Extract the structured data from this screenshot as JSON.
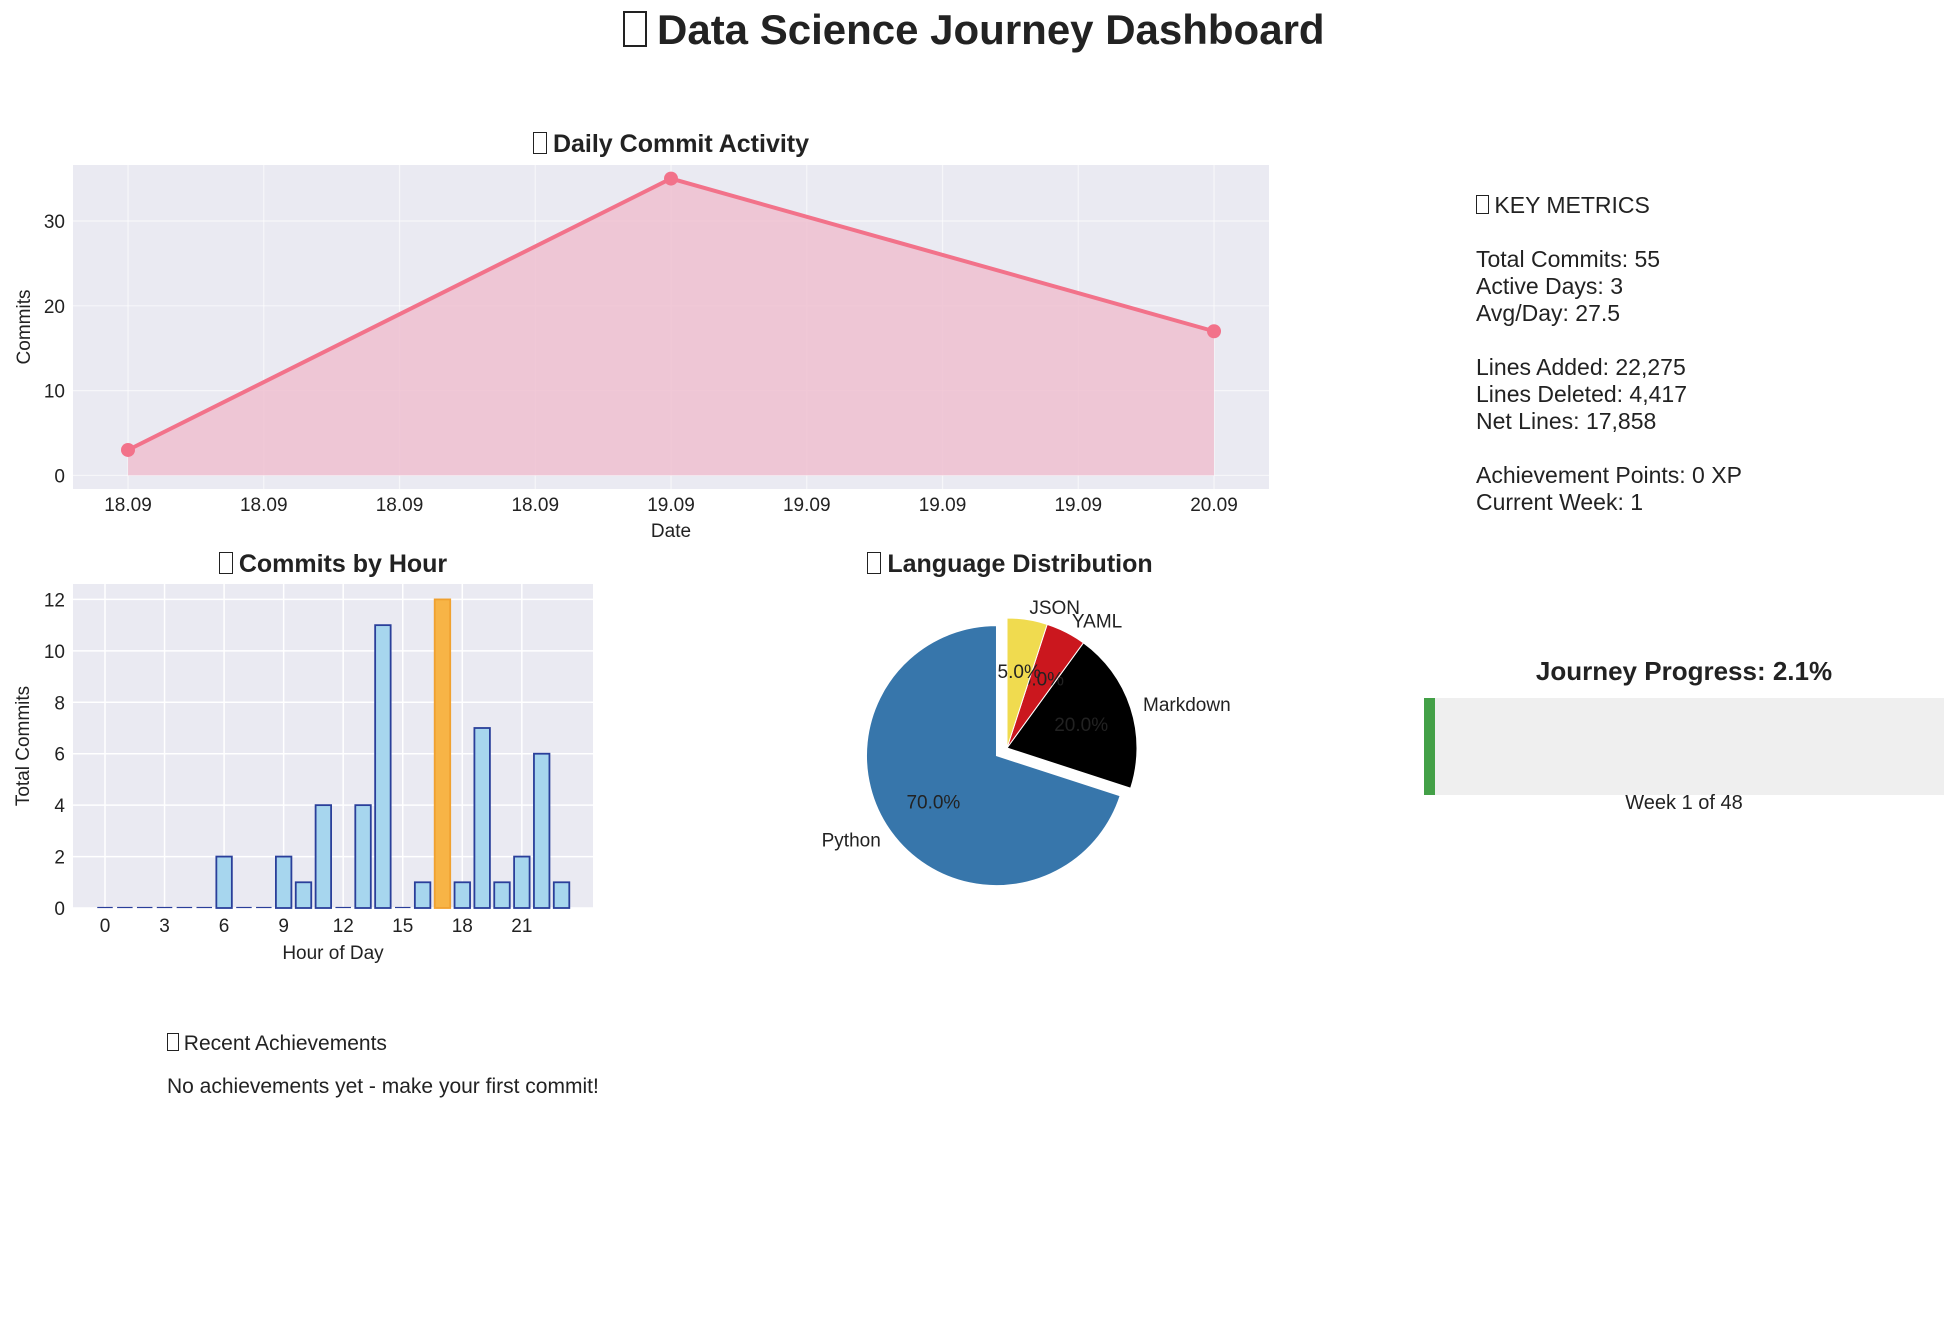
{
  "dashboard": {
    "title": "Data Science Journey Dashboard",
    "title_icon": "chart-emoji-icon"
  },
  "chart_data": [
    {
      "id": "daily",
      "type": "area",
      "title": "Daily Commit Activity",
      "title_icon": "emoji-icon",
      "xlabel": "Date",
      "ylabel": "Commits",
      "x_ticks": [
        "18.09",
        "18.09",
        "18.09",
        "18.09",
        "19.09",
        "19.09",
        "19.09",
        "19.09",
        "20.09"
      ],
      "x": [
        "18.09",
        "19.09",
        "20.09"
      ],
      "values": [
        3,
        35,
        17
      ],
      "y_ticks": [
        0,
        10,
        20,
        30
      ],
      "ylim": [
        -1.6,
        36.6
      ],
      "grid": true,
      "color": "#f2728a",
      "fill_color": "#efbfd0",
      "background": "#eaeaf2"
    },
    {
      "id": "hourly",
      "type": "bar",
      "title": "Commits by Hour",
      "title_icon": "emoji-icon",
      "xlabel": "Hour of Day",
      "ylabel": "Total Commits",
      "categories": [
        0,
        1,
        2,
        3,
        4,
        5,
        6,
        7,
        8,
        9,
        10,
        11,
        12,
        13,
        14,
        15,
        16,
        17,
        18,
        19,
        20,
        21,
        22,
        23
      ],
      "values": [
        0,
        0,
        0,
        0,
        0,
        0,
        2,
        0,
        0,
        2,
        1,
        4,
        0,
        4,
        11,
        0,
        1,
        12,
        1,
        7,
        1,
        2,
        6,
        1
      ],
      "highlight_index": 17,
      "x_ticks": [
        0,
        3,
        6,
        9,
        12,
        15,
        18,
        21
      ],
      "y_ticks": [
        0,
        2,
        4,
        6,
        8,
        10,
        12
      ],
      "ylim": [
        0,
        12.6
      ],
      "grid": true,
      "bar_color": "#a7d6ee",
      "bar_edge": "#2a3f9a",
      "highlight_color": "#f7b446",
      "highlight_edge": "#f0a130",
      "background": "#eaeaf2"
    },
    {
      "id": "languages",
      "type": "pie",
      "title": "Language Distribution",
      "title_icon": "emoji-icon",
      "slices": [
        {
          "label": "Python",
          "value": 70.0,
          "pct_label": "70.0%",
          "color": "#3776ab"
        },
        {
          "label": "Markdown",
          "value": 20.0,
          "pct_label": "20.0%",
          "color": "#000000"
        },
        {
          "label": "YAML",
          "value": 5.0,
          "pct_label": "5.0%",
          "color": "#cb171e"
        },
        {
          "label": "JSON",
          "value": 5.0,
          "pct_label": "5.0%",
          "color": "#f0db4f"
        }
      ],
      "start_angle_deg": 90,
      "exploded": "Python"
    }
  ],
  "metrics": {
    "heading": "KEY METRICS",
    "total_commits": "Total Commits: 55",
    "active_days": "Active Days: 3",
    "avg_day": "Avg/Day: 27.5",
    "lines_added": "Lines Added: 22,275",
    "lines_deleted": "Lines Deleted: 4,417",
    "net_lines": "Net Lines: 17,858",
    "achievement_points": "Achievement Points: 0 XP",
    "current_week": "Current Week: 1"
  },
  "progress": {
    "title": "Journey Progress: 2.1%",
    "percent": 2.1,
    "label": "Week 1 of 48",
    "color": "#43a047"
  },
  "achievements": {
    "heading": "Recent Achievements",
    "message": "No achievements yet - make your first commit!"
  }
}
